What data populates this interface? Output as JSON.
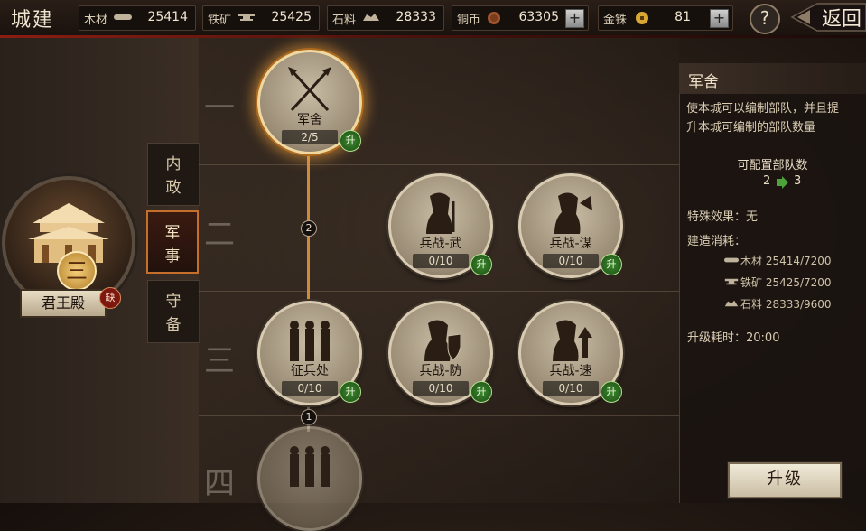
{
  "header": {
    "title": "城建",
    "back_label": "返回",
    "help_label": "?"
  },
  "resources": [
    {
      "label": "木材",
      "icon": "wood-icon",
      "value": "25414"
    },
    {
      "label": "铁矿",
      "icon": "anvil-icon",
      "value": "25425"
    },
    {
      "label": "石料",
      "icon": "stone-icon",
      "value": "28333"
    },
    {
      "label": "铜币",
      "icon": "coin-icon",
      "value": "63305"
    },
    {
      "label": "金铢",
      "icon": "gold-coin-icon",
      "value": "81"
    }
  ],
  "palace": {
    "level": "三",
    "name": "君王殿",
    "badge": "缺"
  },
  "categories": [
    {
      "label": "内\n政",
      "id": "internal"
    },
    {
      "label": "军\n事",
      "id": "military"
    },
    {
      "label": "守\n备",
      "id": "defense"
    }
  ],
  "tiers": [
    "一",
    "二",
    "三",
    "四"
  ],
  "nodes": [
    {
      "name": "军舍",
      "progress": "2/5",
      "upgrade": "升",
      "icon": "crossed-spears-icon"
    },
    {
      "name": "兵战-武",
      "progress": "0/10",
      "upgrade": "升",
      "icon": "soldier-sword-icon"
    },
    {
      "name": "兵战-谋",
      "progress": "0/10",
      "upgrade": "升",
      "icon": "soldier-fan-icon"
    },
    {
      "name": "征兵处",
      "progress": "0/10",
      "upgrade": "升",
      "icon": "recruits-icon"
    },
    {
      "name": "兵战-防",
      "progress": "0/10",
      "upgrade": "升",
      "icon": "soldier-shield-icon"
    },
    {
      "name": "兵战-速",
      "progress": "0/10",
      "upgrade": "升",
      "icon": "soldier-speed-icon"
    }
  ],
  "connectors": [
    "2",
    "1"
  ],
  "panel": {
    "title": "军舍",
    "desc_line1": "使本城可以编制部队，并且提",
    "desc_line2": "升本城可编制的部队数量",
    "capacity_label": "可配置部队数",
    "capacity_from": "2",
    "capacity_to": "3",
    "special_label": "特殊效果：无",
    "cost_label": "建造消耗：",
    "costs": [
      {
        "text": "木材 25414/7200",
        "icon": "wood-icon"
      },
      {
        "text": "铁矿 25425/7200",
        "icon": "anvil-icon"
      },
      {
        "text": "石料 28333/9600",
        "icon": "stone-icon"
      }
    ],
    "time_label": "升级耗时：20:00",
    "upgrade_button": "升级"
  },
  "colors": {
    "accent": "#d08a3a",
    "upgrade_green": "#3d8a2e",
    "header_red": "#8b1d12"
  }
}
